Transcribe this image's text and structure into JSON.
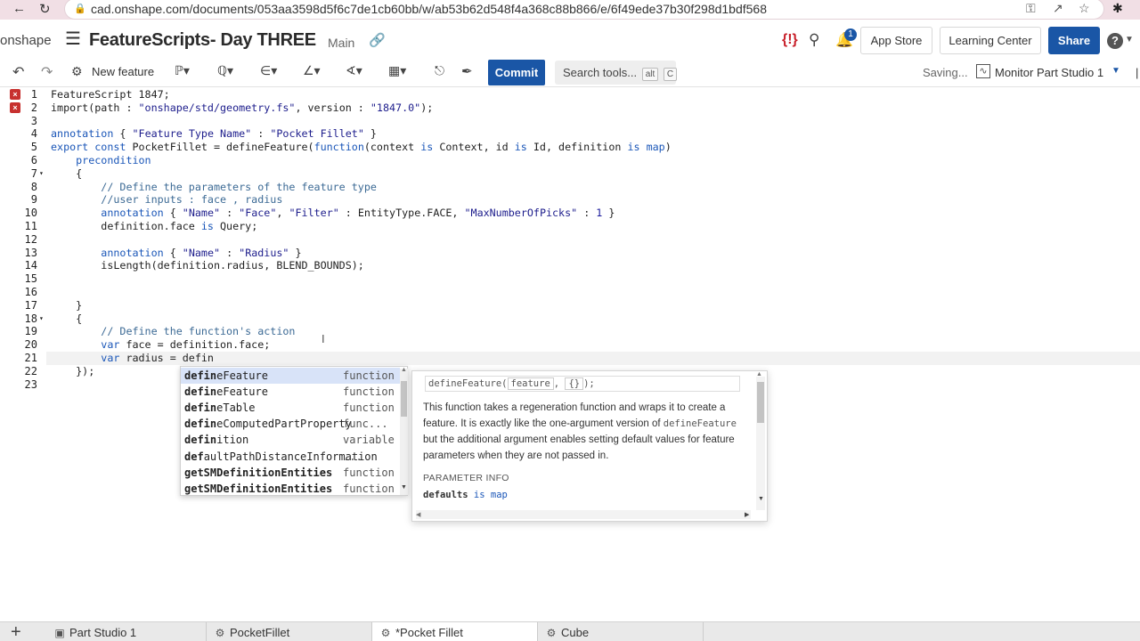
{
  "browser": {
    "url": "cad.onshape.com/documents/053aa3598d5f6c7de1cb60bb/w/ab53b62d548f4a368c88b866/e/6f49ede37b30f298d1bdf568",
    "back_icon": "arrow-left-icon",
    "reload_icon": "reload-icon"
  },
  "header": {
    "logo": "onshape",
    "title": "FeatureScripts- Day THREE",
    "branch": "Main",
    "error_badge": "{!}",
    "notifications_count": "1",
    "app_store": "App Store",
    "learning_center": "Learning Center",
    "share": "Share",
    "help": "?"
  },
  "toolbar": {
    "new_feature": "New feature",
    "commit": "Commit",
    "search_tools": "Search tools...",
    "shortcut_alt": "alt",
    "shortcut_c": "C",
    "saving": "Saving...",
    "monitor": "Monitor Part Studio 1"
  },
  "editor": {
    "line_numbers": [
      "1",
      "2",
      "3",
      "4",
      "5",
      "6",
      "7",
      "8",
      "9",
      "10",
      "11",
      "12",
      "13",
      "14",
      "15",
      "16",
      "17",
      "18",
      "19",
      "20",
      "21",
      "22",
      "23"
    ],
    "error_lines": [
      "1",
      "2"
    ],
    "lines": [
      [
        [
          "plain",
          "FeatureScript 1847;"
        ]
      ],
      [
        [
          "plain",
          "import(path : "
        ],
        [
          "str",
          "\"onshape/std/geometry.fs\""
        ],
        [
          "plain",
          ", version : "
        ],
        [
          "str",
          "\"1847.0\""
        ],
        [
          "plain",
          ");"
        ]
      ],
      [],
      [
        [
          "kw",
          "annotation"
        ],
        [
          "plain",
          " { "
        ],
        [
          "str",
          "\"Feature Type Name\""
        ],
        [
          "plain",
          " : "
        ],
        [
          "str",
          "\"Pocket Fillet\""
        ],
        [
          "plain",
          " }"
        ]
      ],
      [
        [
          "kw",
          "export const"
        ],
        [
          "plain",
          " PocketFillet = defineFeature("
        ],
        [
          "kw",
          "function"
        ],
        [
          "plain",
          "(context "
        ],
        [
          "kw",
          "is"
        ],
        [
          "plain",
          " Context, id "
        ],
        [
          "kw",
          "is"
        ],
        [
          "plain",
          " Id, definition "
        ],
        [
          "kw",
          "is"
        ],
        [
          "plain",
          " "
        ],
        [
          "kw",
          "map"
        ],
        [
          "plain",
          ")"
        ]
      ],
      [
        [
          "kw",
          "    precondition"
        ]
      ],
      [
        [
          "plain",
          "    {"
        ]
      ],
      [
        [
          "cm",
          "        // Define the parameters of the feature type"
        ]
      ],
      [
        [
          "cm",
          "        //user inputs : face , radius"
        ]
      ],
      [
        [
          "kw",
          "        annotation"
        ],
        [
          "plain",
          " { "
        ],
        [
          "str",
          "\"Name\""
        ],
        [
          "plain",
          " : "
        ],
        [
          "str",
          "\"Face\""
        ],
        [
          "plain",
          ", "
        ],
        [
          "str",
          "\"Filter\""
        ],
        [
          "plain",
          " : EntityType.FACE, "
        ],
        [
          "str",
          "\"MaxNumberOfPicks\""
        ],
        [
          "plain",
          " : "
        ],
        [
          "num",
          "1"
        ],
        [
          "plain",
          " }"
        ]
      ],
      [
        [
          "plain",
          "        definition.face "
        ],
        [
          "kw",
          "is"
        ],
        [
          "plain",
          " Query;"
        ]
      ],
      [],
      [
        [
          "kw",
          "        annotation"
        ],
        [
          "plain",
          " { "
        ],
        [
          "str",
          "\"Name\""
        ],
        [
          "plain",
          " : "
        ],
        [
          "str",
          "\"Radius\""
        ],
        [
          "plain",
          " }"
        ]
      ],
      [
        [
          "plain",
          "        isLength(definition.radius, BLEND_BOUNDS);"
        ]
      ],
      [],
      [],
      [
        [
          "plain",
          "    }"
        ]
      ],
      [
        [
          "plain",
          "    {"
        ]
      ],
      [
        [
          "cm",
          "        // Define the function's action"
        ]
      ],
      [
        [
          "kw",
          "        var"
        ],
        [
          "plain",
          " face = definition.face;"
        ]
      ],
      [
        [
          "kw",
          "        var"
        ],
        [
          "plain",
          " radius = defin"
        ]
      ],
      [
        [
          "plain",
          "    });"
        ]
      ],
      []
    ]
  },
  "autocomplete": {
    "items": [
      {
        "pre": "defin",
        "rest": "eFeature",
        "type": "function"
      },
      {
        "pre": "defin",
        "rest": "eFeature",
        "type": "function"
      },
      {
        "pre": "defin",
        "rest": "eTable",
        "type": "function"
      },
      {
        "pre": "defin",
        "rest": "eComputedPartProperty",
        "type": "func..."
      },
      {
        "pre": "defin",
        "rest": "ition",
        "type": "variable"
      },
      {
        "pre": "def",
        "rest": "aultPathDistanceInformation",
        "type": "..."
      },
      {
        "pre": "getSMDefinitionEntities",
        "rest": "",
        "type": "function"
      },
      {
        "pre": "getSMDefinitionEntities",
        "rest": "",
        "type": "function"
      }
    ]
  },
  "doc": {
    "sig_name": "defineFeature(",
    "sig_arg1": "feature",
    "sig_sep": ", ",
    "sig_arg2": "{}",
    "sig_end": ");",
    "desc_1": "This function takes a regeneration function and wraps it to create a feature. It is exactly like the one-argument version of ",
    "desc_code": "defineFeature",
    "desc_2": " but the additional argument enables setting default values for feature parameters when they are not passed in.",
    "param_header": "PARAMETER INFO",
    "param_name": "defaults",
    "param_is": "is",
    "param_type": "map"
  },
  "tabs": [
    {
      "label": "Part Studio 1",
      "icon": "part-studio-icon"
    },
    {
      "label": "PocketFillet",
      "icon": "featurescript-icon"
    },
    {
      "label": "*Pocket Fillet",
      "icon": "featurescript-icon"
    },
    {
      "label": "Cube",
      "icon": "featurescript-icon"
    }
  ]
}
